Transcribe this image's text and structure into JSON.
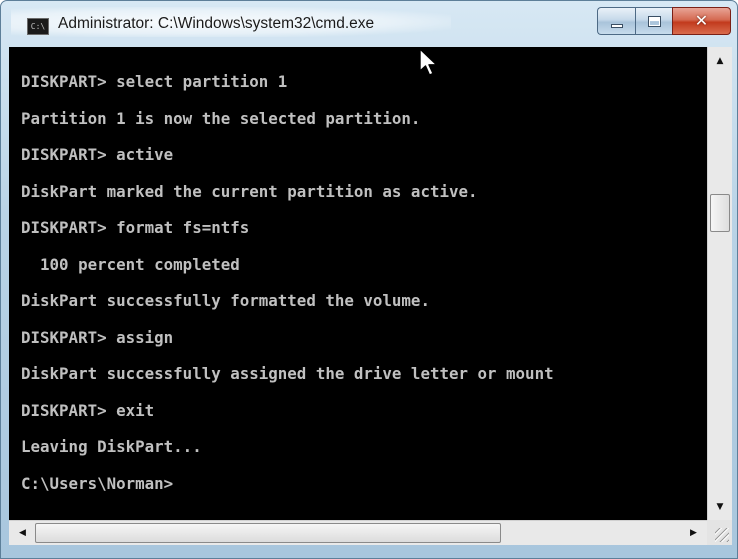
{
  "window": {
    "title": "Administrator: C:\\Windows\\system32\\cmd.exe",
    "icon_label": "C:\\",
    "icon": "cmd-prompt-icon"
  },
  "caption_buttons": {
    "minimize": "minimize-icon",
    "maximize": "maximize-icon",
    "close": "close-icon",
    "close_glyph": "✕"
  },
  "console": {
    "lines": [
      "DISKPART> select partition 1",
      "Partition 1 is now the selected partition.",
      "DISKPART> active",
      "DiskPart marked the current partition as active.",
      "DISKPART> format fs=ntfs",
      "  100 percent completed",
      "DiskPart successfully formatted the volume.",
      "DISKPART> assign",
      "DiskPart successfully assigned the drive letter or mount",
      "DISKPART> exit",
      "Leaving DiskPart...",
      "C:\\Users\\Norman>"
    ]
  },
  "scrollbars": {
    "up_arrow": "▲",
    "down_arrow": "▼",
    "left_arrow": "◀",
    "right_arrow": "▶"
  },
  "colors": {
    "console_background": "#000000",
    "console_text": "#c0c0c0",
    "close_button": "#c94b2f"
  }
}
